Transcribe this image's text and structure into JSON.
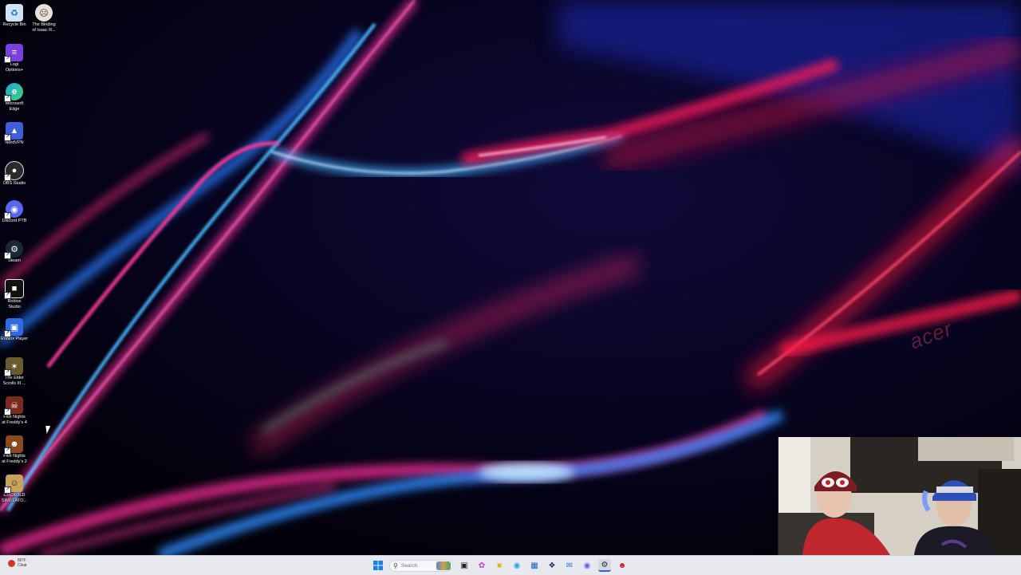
{
  "desktop": {
    "icons": [
      {
        "label": "Recycle Bin",
        "icon": "recycle-bin-icon",
        "color": "#cfe3f7"
      },
      {
        "label": "The Binding\nof Isaac R...",
        "icon": "isaac-icon",
        "color": "#e9e0d8"
      },
      {
        "label": "Logi\nOptions+",
        "icon": "logi-icon",
        "color": "#7b3fe0"
      },
      {
        "label": "Microsoft\nEdge",
        "icon": "edge-icon",
        "color": "#1fa5d8"
      },
      {
        "label": "NordVPN",
        "icon": "nordvpn-icon",
        "color": "#3e5fd9"
      },
      {
        "label": "OBS Studio",
        "icon": "obs-icon",
        "color": "#2a2a2a"
      },
      {
        "label": "Discord PTB",
        "icon": "discord-icon",
        "color": "#5865f2"
      },
      {
        "label": "Steam",
        "icon": "steam-icon",
        "color": "#1b2838"
      },
      {
        "label": "Roblox\nStudio",
        "icon": "roblox-studio-icon",
        "color": "#111111"
      },
      {
        "label": "Roblox Player",
        "icon": "roblox-player-icon",
        "color": "#2f6be0"
      },
      {
        "label": "The Elder\nScrolls III ...",
        "icon": "elder-scrolls-icon",
        "color": "#6b5a2e"
      },
      {
        "label": "Five Nights\nat Freddy's 4",
        "icon": "fnaf4-icon",
        "color": "#7a2a1e"
      },
      {
        "label": "Five Nights\nat Freddy's 2",
        "icon": "fnaf2-icon",
        "color": "#8a4a20"
      },
      {
        "label": "CUCKOLD\nSIMULATO...",
        "icon": "cuckold-simulator-icon",
        "color": "#c8a15a"
      }
    ]
  },
  "wallpaper": {
    "watermark": "acer",
    "colors": {
      "background": "#02010a",
      "pink": "#ff2f7a",
      "blue": "#2f9bff",
      "red": "#ff1240"
    }
  },
  "taskbar": {
    "weather": {
      "temp": "80°F",
      "condition": "Clear"
    },
    "search_placeholder": "Search",
    "icons": [
      "windows-start-icon",
      "task-view-icon",
      "copilot-icon",
      "file-explorer-icon",
      "edge-icon",
      "store-icon",
      "dropbox-icon",
      "mail-icon",
      "discord-icon",
      "steam-icon",
      "isaac-icon"
    ],
    "active_icon": "steam-icon"
  }
}
